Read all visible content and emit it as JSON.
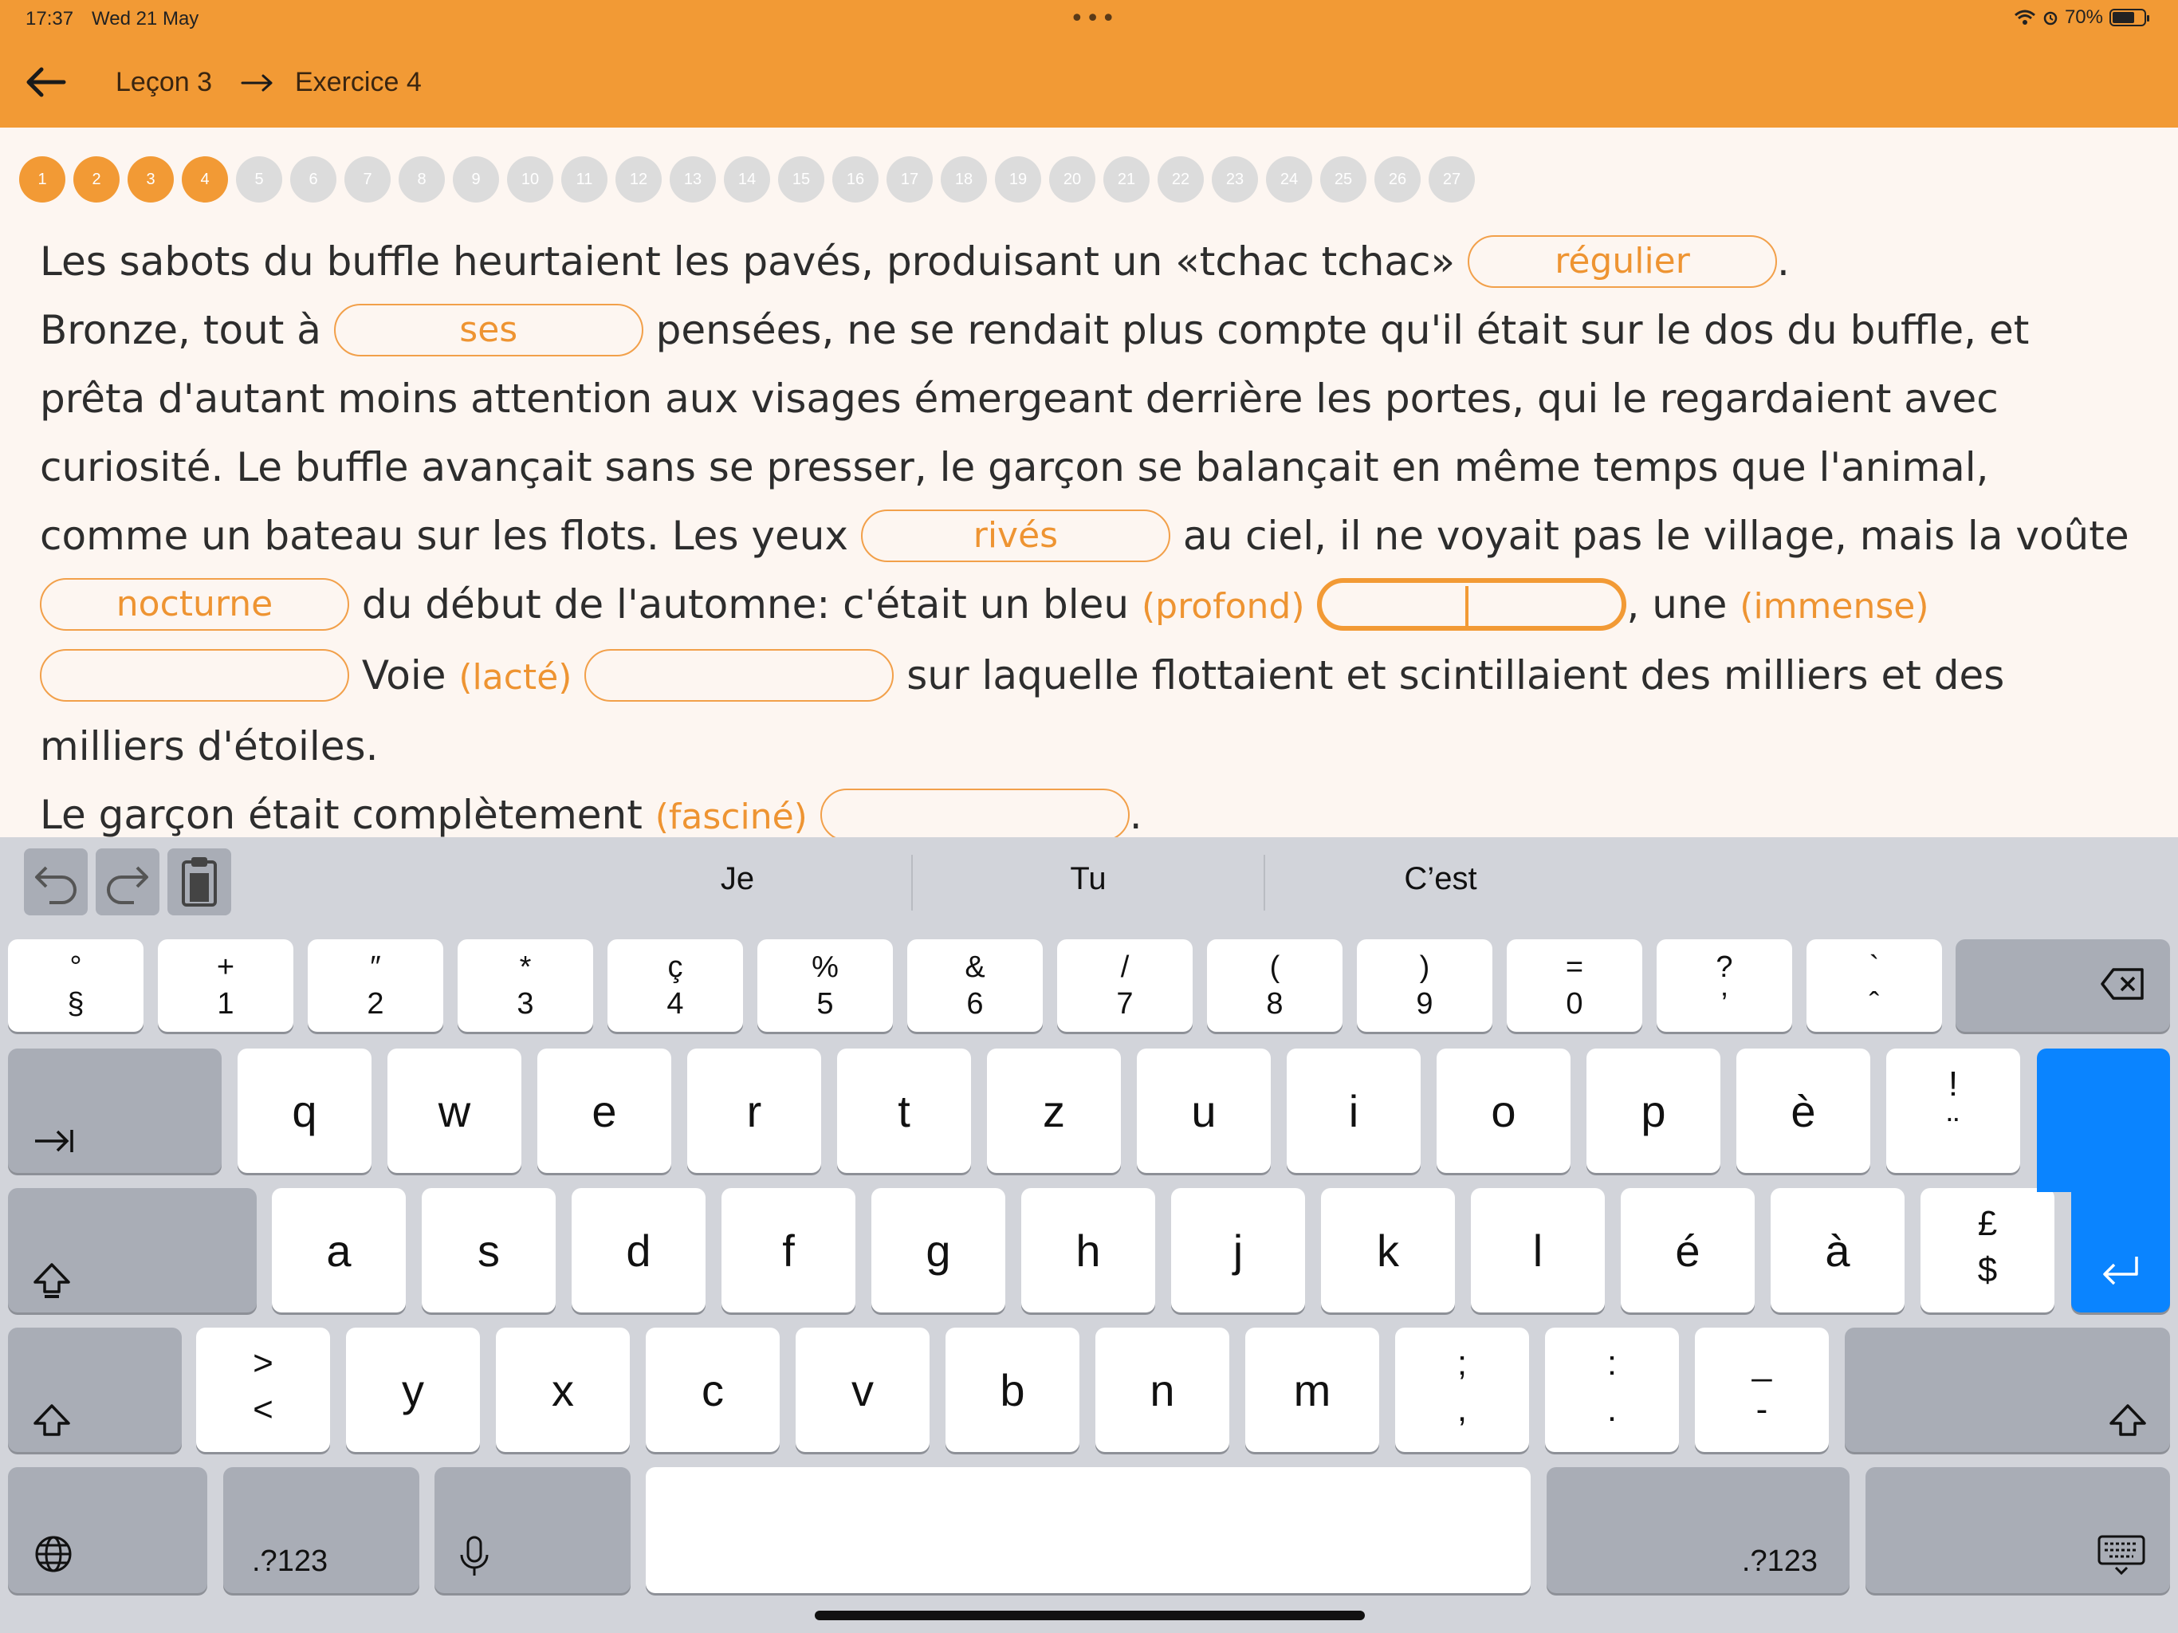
{
  "status_bar": {
    "time": "17:37",
    "date": "Wed 21 May",
    "battery": "70%",
    "battery_level": 0.7
  },
  "header": {
    "back_icon": "arrow-left-icon",
    "breadcrumb": {
      "lesson": "Leçon 3",
      "exercise": "Exercice 4"
    },
    "background_color": "#f29a35"
  },
  "progress": {
    "steps": [
      "1",
      "2",
      "3",
      "4",
      "5",
      "6",
      "7",
      "8",
      "9",
      "10",
      "11",
      "12",
      "13",
      "14",
      "15",
      "16",
      "17",
      "18",
      "19",
      "20",
      "21",
      "22",
      "23",
      "24",
      "25",
      "26",
      "27"
    ],
    "completed": 4,
    "done_color": "#f29a35",
    "todo_color": "#dcdcdc"
  },
  "exercise": {
    "s1": "Les sabots du buffle heurtaient les pavés, produisant un «tchac tchac»",
    "b1": "régulier",
    "s2": ".",
    "s3": "Bronze, tout à",
    "b2": "ses",
    "s4": "pensées, ne se rendait plus compte qu'il était sur le dos du buffle, et prêta d'autant moins attention aux visages émergeant derrière les portes, qui le regardaient avec curiosité. Le buffle avançait sans se presser, le garçon se balançait en même temps que l'animal, comme un bateau sur les flots. Les yeux",
    "b3": "rivés",
    "s5": "au ciel, il ne voyait pas le village, mais la voûte",
    "b4": "nocturne",
    "s6": "du début de l'automne: c'était un bleu",
    "h1": "(profond)",
    "b5": "",
    "s7": ", une",
    "h2": "(immense)",
    "b6": "",
    "s8": "Voie",
    "h3": "(lacté)",
    "b7": "",
    "s9": "sur laquelle flottaient et scintillaient des milliers et des milliers d'étoiles.",
    "s10": "Le garçon était complètement",
    "h4": "(fasciné)",
    "b8": "",
    "s11": "."
  },
  "keyboard": {
    "toolbar": {
      "undo": "undo-icon",
      "redo": "redo-icon",
      "paste": "paste-icon"
    },
    "suggestions": [
      "Je",
      "Tu",
      "C’est"
    ],
    "row1": [
      {
        "top": "°",
        "bottom": "§"
      },
      {
        "top": "+",
        "bottom": "1"
      },
      {
        "top": "″",
        "bottom": "2"
      },
      {
        "top": "*",
        "bottom": "3"
      },
      {
        "top": "ç",
        "bottom": "4"
      },
      {
        "top": "%",
        "bottom": "5"
      },
      {
        "top": "&",
        "bottom": "6"
      },
      {
        "top": "/",
        "bottom": "7"
      },
      {
        "top": "(",
        "bottom": "8"
      },
      {
        "top": ")",
        "bottom": "9"
      },
      {
        "top": "=",
        "bottom": "0"
      },
      {
        "top": "?",
        "bottom": "’"
      },
      {
        "top": "`",
        "bottom": "ˆ"
      }
    ],
    "row2": [
      "q",
      "w",
      "e",
      "r",
      "t",
      "z",
      "u",
      "i",
      "o",
      "p",
      "è"
    ],
    "row2_last": {
      "top": "!",
      "bottom": "¨"
    },
    "row3": [
      "a",
      "s",
      "d",
      "f",
      "g",
      "h",
      "j",
      "k",
      "l",
      "é",
      "à"
    ],
    "row3_last": {
      "top": "£",
      "bottom": "$"
    },
    "row4_first": {
      "top": ">",
      "bottom": "<"
    },
    "row4": [
      "y",
      "x",
      "c",
      "v",
      "b",
      "n",
      "m"
    ],
    "row4_punct": [
      {
        "top": ";",
        "bottom": ","
      },
      {
        "top": ":",
        "bottom": "."
      },
      {
        "top": "_",
        "bottom": "-"
      }
    ],
    "numbers_label": ".?123",
    "icons": {
      "delete": "delete-icon",
      "tab": "tab-icon",
      "caps": "caps-lock-icon",
      "shift": "shift-icon",
      "return": "return-icon",
      "globe": "globe-icon",
      "mic": "microphone-icon",
      "hide": "keyboard-hide-icon"
    },
    "return_color": "#0a84ff"
  }
}
